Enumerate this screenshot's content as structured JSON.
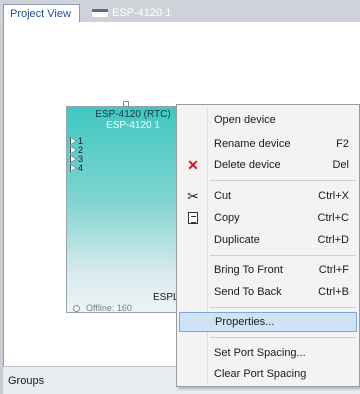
{
  "tabs": [
    {
      "label": "Project View",
      "active": true
    },
    {
      "label": "ESP-4120 1",
      "active": false
    }
  ],
  "device": {
    "title": "ESP-4120 (RTC)",
    "name": "ESP-4120 1",
    "ports": [
      "1",
      "2",
      "3",
      "4"
    ],
    "bottom_label": "ESPL",
    "status": "Offline: 160"
  },
  "context_menu": {
    "items": [
      {
        "label": "Open device",
        "shortcut": ""
      },
      {
        "label": "Rename device",
        "shortcut": "F2"
      },
      {
        "label": "Delete device",
        "shortcut": "Del",
        "icon": "delete-x-icon"
      },
      {
        "label": "Cut",
        "shortcut": "Ctrl+X",
        "icon": "scissors-icon"
      },
      {
        "label": "Copy",
        "shortcut": "Ctrl+C",
        "icon": "copy-icon"
      },
      {
        "label": "Duplicate",
        "shortcut": "Ctrl+D"
      },
      {
        "label": "Bring To Front",
        "shortcut": "Ctrl+F"
      },
      {
        "label": "Send To Back",
        "shortcut": "Ctrl+B"
      },
      {
        "label": "Properties...",
        "shortcut": "",
        "highlighted": true
      },
      {
        "label": "Set Port Spacing...",
        "shortcut": ""
      },
      {
        "label": "Clear Port Spacing",
        "shortcut": ""
      }
    ]
  },
  "groups_panel": {
    "label": "Groups"
  },
  "colors": {
    "highlight": "#cfe3f7",
    "accent": "#1f4d9a",
    "delete": "#d01818"
  }
}
